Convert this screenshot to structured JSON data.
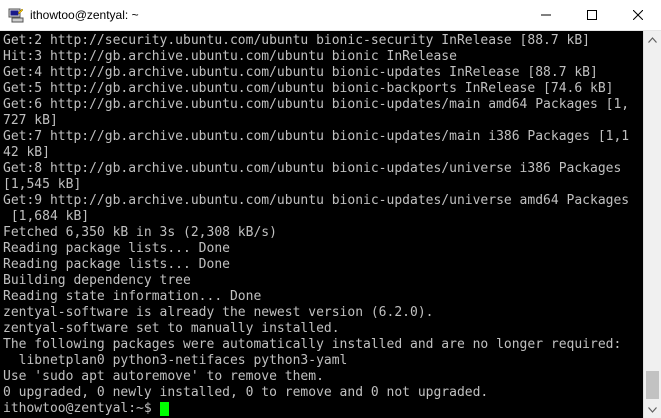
{
  "window": {
    "title": "ithowtoo@zentyal: ~",
    "app_icon": "putty-icon",
    "controls": {
      "minimize_icon": "minimize-icon",
      "maximize_icon": "maximize-icon",
      "close_icon": "close-icon"
    }
  },
  "terminal": {
    "lines": [
      "Get:2 http://security.ubuntu.com/ubuntu bionic-security InRelease [88.7 kB]",
      "Hit:3 http://gb.archive.ubuntu.com/ubuntu bionic InRelease",
      "Get:4 http://gb.archive.ubuntu.com/ubuntu bionic-updates InRelease [88.7 kB]",
      "Get:5 http://gb.archive.ubuntu.com/ubuntu bionic-backports InRelease [74.6 kB]",
      "Get:6 http://gb.archive.ubuntu.com/ubuntu bionic-updates/main amd64 Packages [1,",
      "727 kB]",
      "Get:7 http://gb.archive.ubuntu.com/ubuntu bionic-updates/main i386 Packages [1,1",
      "42 kB]",
      "Get:8 http://gb.archive.ubuntu.com/ubuntu bionic-updates/universe i386 Packages",
      "[1,545 kB]",
      "Get:9 http://gb.archive.ubuntu.com/ubuntu bionic-updates/universe amd64 Packages",
      " [1,684 kB]",
      "Fetched 6,350 kB in 3s (2,308 kB/s)",
      "Reading package lists... Done",
      "Reading package lists... Done",
      "Building dependency tree",
      "Reading state information... Done",
      "zentyal-software is already the newest version (6.2.0).",
      "zentyal-software set to manually installed.",
      "The following packages were automatically installed and are no longer required:",
      "  libnetplan0 python3-netifaces python3-yaml",
      "Use 'sudo apt autoremove' to remove them.",
      "0 upgraded, 0 newly installed, 0 to remove and 0 not upgraded."
    ],
    "prompt": "ithowtoo@zentyal:~$ ",
    "cursor_color": "#00ff00",
    "text_color": "#c0c0c0",
    "background": "#000000"
  },
  "scrollbar": {
    "up_icon": "scroll-up-arrow-icon",
    "down_icon": "scroll-down-arrow-icon"
  }
}
